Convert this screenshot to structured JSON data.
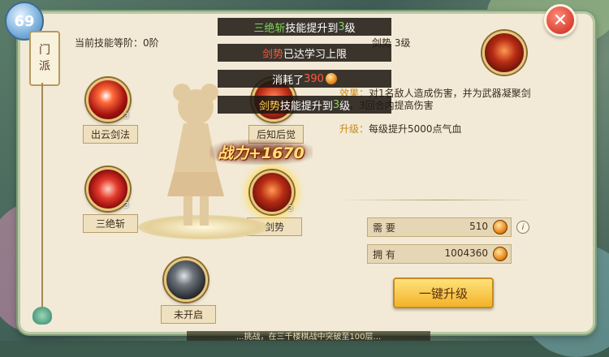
{
  "header": {
    "avatar_text": "69",
    "close_label": "✕"
  },
  "side_tab": {
    "label_line1": "门",
    "label_line2": "派"
  },
  "level": {
    "label": "当前技能等阶：0阶"
  },
  "skills": [
    {
      "name": "出云剑法",
      "level": "3",
      "icon": "fire-slash-icon"
    },
    {
      "name": "后知后觉",
      "level": "",
      "icon": "red-orb-icon"
    },
    {
      "name": "三绝斩",
      "level": "3",
      "icon": "triple-slash-icon"
    },
    {
      "name": "剑势",
      "level": "3",
      "icon": "sword-aura-icon"
    },
    {
      "name": "未开启",
      "level": "",
      "icon": "locked-orb-icon"
    }
  ],
  "power_gain": "战力+1670",
  "detail": {
    "skill_name": "剑势",
    "skill_level": "3级",
    "effect_key": "效果：",
    "effect_text": "对1名敌人造成伤害，并为武器凝聚剑气，3回合内提高伤害",
    "upgrade_key": "升级：",
    "upgrade_text": "每级提升5000点气血"
  },
  "resources": {
    "need_label": "需 要",
    "need_value": "510",
    "have_label": "拥 有",
    "have_value": "1004360"
  },
  "oneclick_label": "一键升级",
  "toasts": [
    {
      "pre": "",
      "highlight": "三绝斩",
      "mid": "技能提升到",
      "num": "3",
      "post": "级"
    },
    {
      "pre": "",
      "highlight": "剑势",
      "mid": "已达学习上限",
      "num": "",
      "post": ""
    },
    {
      "pre": "消耗了",
      "highlight": "",
      "mid": "",
      "num": "390",
      "post": ""
    },
    {
      "pre": "",
      "highlight": "剑势",
      "mid": "技能提升到",
      "num": "3",
      "post": "级"
    }
  ],
  "bottom_tip": "...挑战，在三千楼棋战中突破至100层...",
  "colors": {
    "accent_gold": "#f2b32a",
    "toast_bg": "#1c1612",
    "highlight_green": "#7bd756",
    "highlight_red": "#ff5a3c",
    "highlight_yellow": "#ffd54a"
  }
}
